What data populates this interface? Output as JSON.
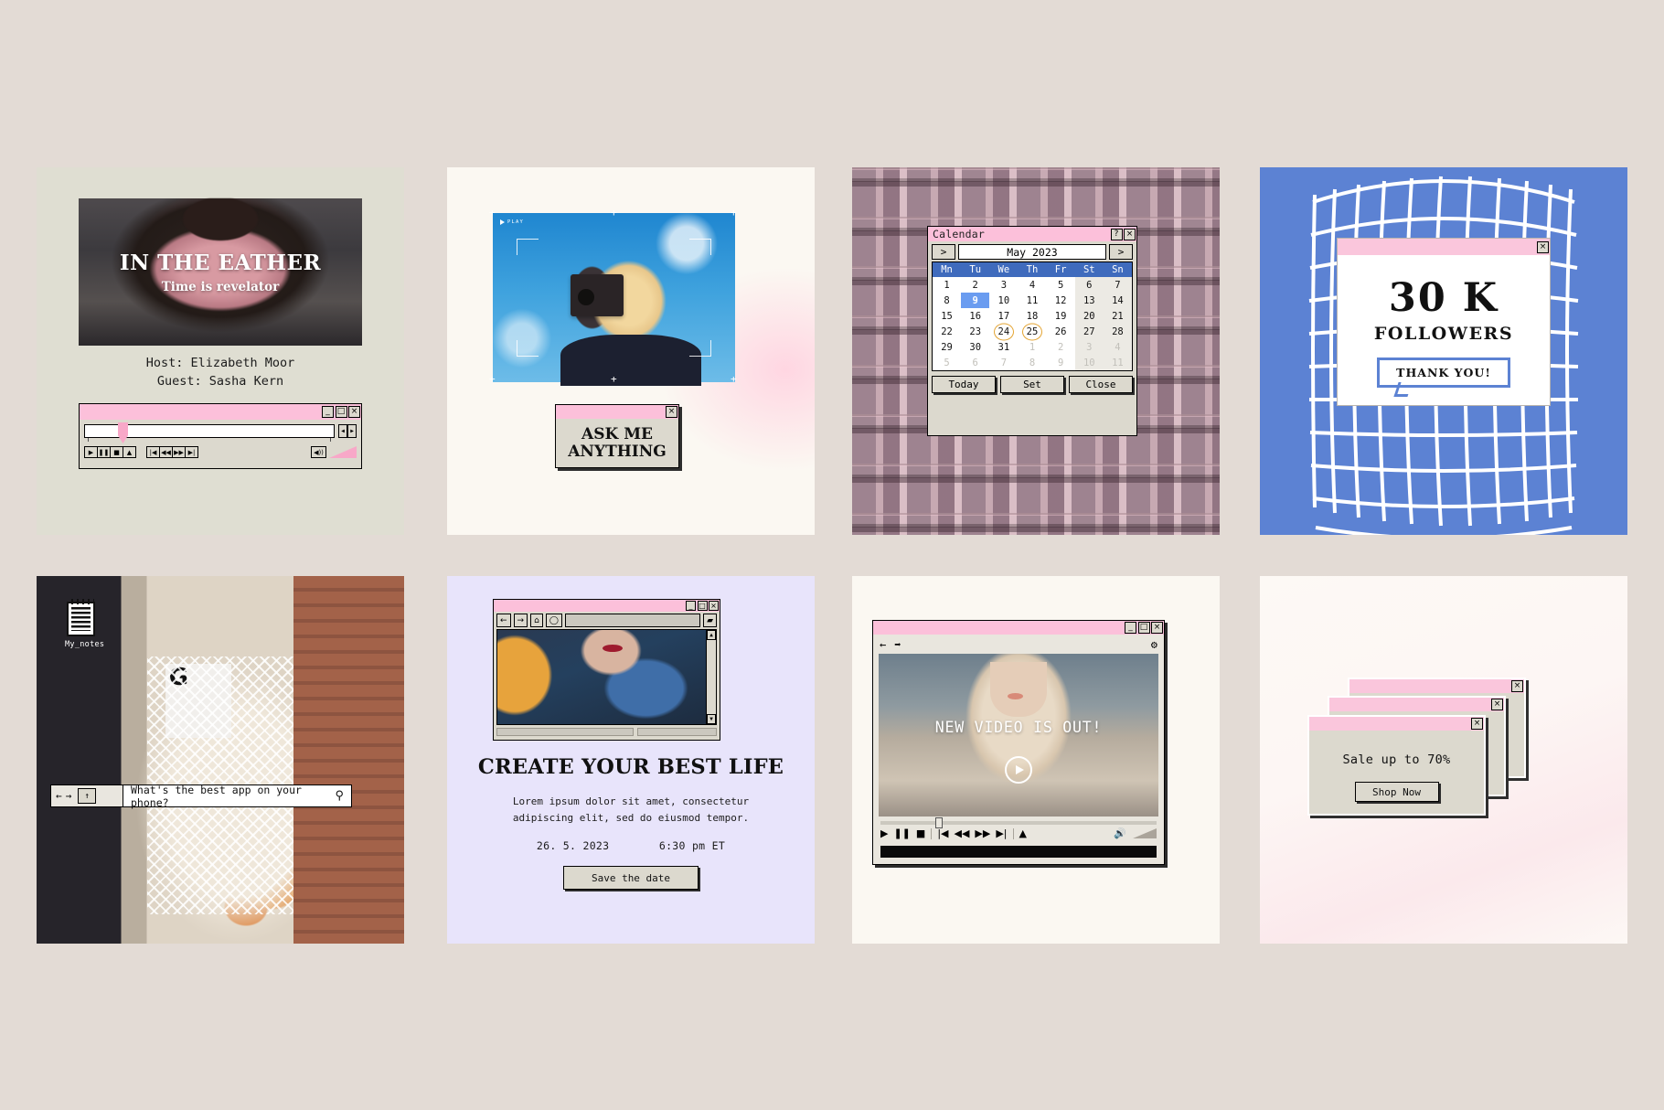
{
  "page": {
    "background_color": "#e3dbd5"
  },
  "card1": {
    "name": "podcast-announcement",
    "headline": "IN THE EATHER",
    "subhead": "Time is revelator",
    "host": "Host: Elizabeth Moor",
    "guest": "Guest: Sasha Kern",
    "window": {
      "minimize": "_",
      "maximize": "□",
      "close": "×"
    },
    "transport": [
      "▶",
      "❚❚",
      "■",
      "▲"
    ],
    "seek_buttons": [
      "|◀",
      "◀◀",
      "▶▶",
      "▶|"
    ],
    "nudge": [
      "◀",
      "▶"
    ],
    "volume_icon": "◀))"
  },
  "card2": {
    "name": "ask-me-anything",
    "play_label": "PLAY",
    "dialog_title": "",
    "close": "×",
    "line1": "ASK ME",
    "line2": "ANYTHING"
  },
  "card3": {
    "name": "calendar-widget",
    "title": "Calendar",
    "help": "?",
    "close": "×",
    "prev": ">",
    "next": ">",
    "month": "May 2023",
    "weekdays": [
      "Mn",
      "Tu",
      "We",
      "Th",
      "Fr",
      "St",
      "Sn"
    ],
    "weeks": [
      [
        {
          "d": "1"
        },
        {
          "d": "2"
        },
        {
          "d": "3"
        },
        {
          "d": "4"
        },
        {
          "d": "5"
        },
        {
          "d": "6",
          "we": true
        },
        {
          "d": "7",
          "we": true
        }
      ],
      [
        {
          "d": "8"
        },
        {
          "d": "9",
          "sel": true
        },
        {
          "d": "10"
        },
        {
          "d": "11"
        },
        {
          "d": "12"
        },
        {
          "d": "13",
          "we": true
        },
        {
          "d": "14",
          "we": true
        }
      ],
      [
        {
          "d": "15"
        },
        {
          "d": "16"
        },
        {
          "d": "17"
        },
        {
          "d": "18"
        },
        {
          "d": "19"
        },
        {
          "d": "20",
          "we": true
        },
        {
          "d": "21",
          "we": true
        }
      ],
      [
        {
          "d": "22"
        },
        {
          "d": "23"
        },
        {
          "d": "24",
          "circ": true
        },
        {
          "d": "25",
          "circ": true
        },
        {
          "d": "26"
        },
        {
          "d": "27",
          "we": true
        },
        {
          "d": "28",
          "we": true
        }
      ],
      [
        {
          "d": "29"
        },
        {
          "d": "30"
        },
        {
          "d": "31"
        },
        {
          "d": "1",
          "mut": true
        },
        {
          "d": "2",
          "mut": true
        },
        {
          "d": "3",
          "mut": true,
          "we": true
        },
        {
          "d": "4",
          "mut": true,
          "we": true
        }
      ],
      [
        {
          "d": "5",
          "mut": true
        },
        {
          "d": "6",
          "mut": true
        },
        {
          "d": "7",
          "mut": true
        },
        {
          "d": "8",
          "mut": true
        },
        {
          "d": "9",
          "mut": true
        },
        {
          "d": "10",
          "mut": true,
          "we": true
        },
        {
          "d": "11",
          "mut": true,
          "we": true
        }
      ]
    ],
    "buttons": [
      "Today",
      "Set",
      "Close"
    ],
    "accent_selected": "#6a9cf0",
    "accent_circle": "#e4a534"
  },
  "card4": {
    "name": "followers-milestone",
    "close": "×",
    "count": "30 K",
    "label": "FOLLOWERS",
    "bubble": "THANK YOU!",
    "bg_color": "#5c82d3"
  },
  "card5": {
    "name": "search-poll",
    "desktop_icon_label": "My_notes",
    "nav_back": "←",
    "nav_forward": "→",
    "nav_up": "↑",
    "search_value": "What's the best app on your phone?",
    "search_icon": "search-icon"
  },
  "card6": {
    "name": "event-save-the-date",
    "window": {
      "minimize": "_",
      "maximize": "□",
      "close": "×"
    },
    "toolbar": [
      "←",
      "→",
      "⌂",
      "◯"
    ],
    "folder_icon": "▰",
    "headline": "CREATE YOUR BEST LIFE",
    "body_line1": "Lorem ipsum dolor sit amet, consectetur",
    "body_line2": "adipiscing elit, sed do eiusmod tempor.",
    "date": "26. 5. 2023",
    "time": "6:30 pm ET",
    "cta": "Save the date"
  },
  "card7": {
    "name": "new-video-announcement",
    "window": {
      "minimize": "_",
      "maximize": "□",
      "close": "×"
    },
    "nav_back": "←",
    "nav_forward": "➡",
    "settings_icon": "gear-icon",
    "headline": "NEW VIDEO IS OUT!",
    "play_icon": "play-icon",
    "controls": [
      "▶",
      "❚❚",
      "■",
      "|◀",
      "◀◀",
      "▶▶",
      "▶|",
      "▲"
    ],
    "volume_icon": "🔊"
  },
  "card8": {
    "name": "sale-popups",
    "close": "×",
    "message": "Sale up to 70%",
    "cta": "Shop Now"
  }
}
